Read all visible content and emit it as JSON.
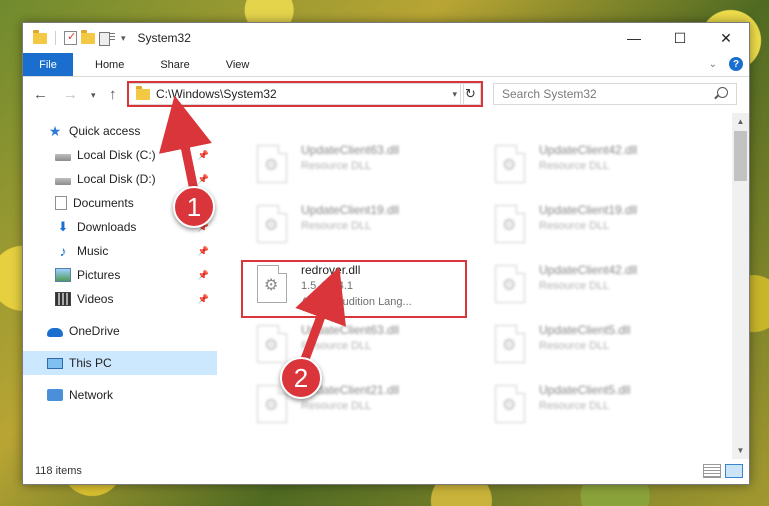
{
  "window": {
    "title": "System32",
    "controls": {
      "minimize": "—",
      "maximize": "☐",
      "close": "✕"
    }
  },
  "ribbon": {
    "tabs": [
      "File",
      "Home",
      "Share",
      "View"
    ],
    "help": "?"
  },
  "address": {
    "path": "C:\\Windows\\System32",
    "search_placeholder": "Search System32"
  },
  "sidebar": {
    "items": [
      {
        "label": "Quick access",
        "icon": "star-icon",
        "pinned": false
      },
      {
        "label": "Local Disk (C:)",
        "icon": "drive-icon",
        "pinned": true
      },
      {
        "label": "Local Disk (D:)",
        "icon": "drive-icon",
        "pinned": true
      },
      {
        "label": "Documents",
        "icon": "documents-icon",
        "pinned": true
      },
      {
        "label": "Downloads",
        "icon": "downloads-icon",
        "pinned": true
      },
      {
        "label": "Music",
        "icon": "music-icon",
        "pinned": true
      },
      {
        "label": "Pictures",
        "icon": "pictures-icon",
        "pinned": true
      },
      {
        "label": "Videos",
        "icon": "videos-icon",
        "pinned": true
      },
      {
        "label": "OneDrive",
        "icon": "onedrive-icon",
        "pinned": false
      },
      {
        "label": "This PC",
        "icon": "this-pc-icon",
        "pinned": false,
        "selected": true
      },
      {
        "label": "Network",
        "icon": "network-icon",
        "pinned": false
      }
    ]
  },
  "files": [
    {
      "name": "UpdateClient63.dll",
      "line2": "Resource DLL",
      "line3": ""
    },
    {
      "name": "UpdateClient42.dll",
      "line2": "Resource DLL",
      "line3": ""
    },
    {
      "name": "UpdateClient19.dll",
      "line2": "Resource DLL",
      "line3": ""
    },
    {
      "name": "UpdateClient19.dll",
      "line2": "Resource DLL",
      "line3": ""
    },
    {
      "name": "redrover.dll",
      "line2": "1.5.4124.1",
      "line3": "Adobe Audition Lang..."
    },
    {
      "name": "UpdateClient42.dll",
      "line2": "Resource DLL",
      "line3": ""
    },
    {
      "name": "UpdateClient63.dll",
      "line2": "Resource DLL",
      "line3": ""
    },
    {
      "name": "UpdateClient5.dll",
      "line2": "Resource DLL",
      "line3": ""
    },
    {
      "name": "UpdateClient21.dll",
      "line2": "Resource DLL",
      "line3": ""
    },
    {
      "name": "UpdateClient5.dll",
      "line2": "Resource DLL",
      "line3": ""
    }
  ],
  "status": {
    "count": "118 items"
  },
  "annotations": {
    "badge1": "1",
    "badge2": "2",
    "color": "#d9353a"
  }
}
